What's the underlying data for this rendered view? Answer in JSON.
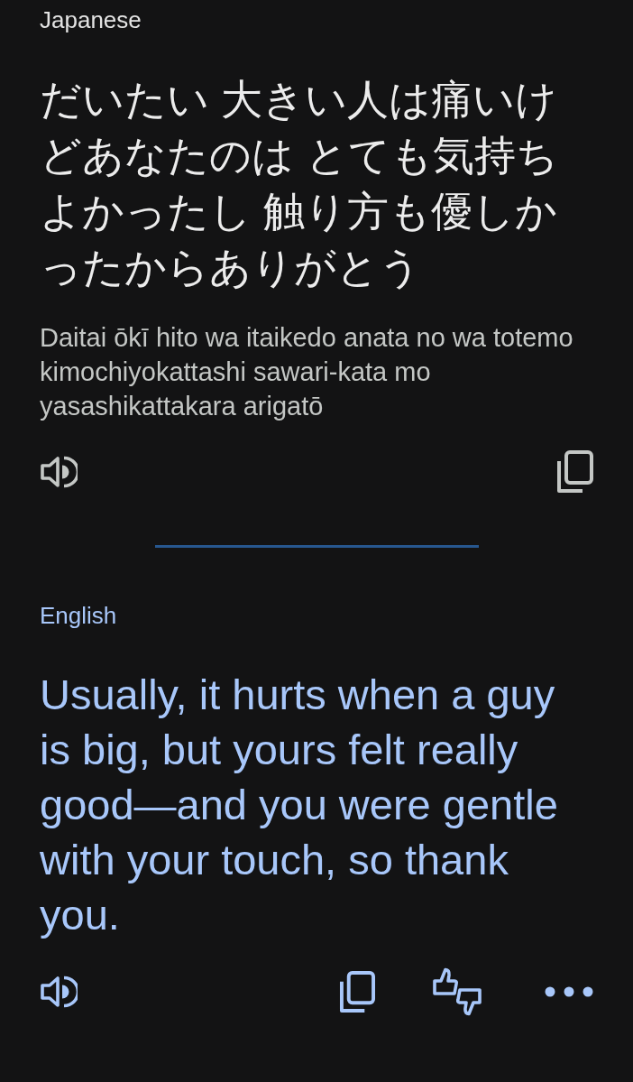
{
  "source": {
    "language": "Japanese",
    "text": "だいたい 大きい人は痛いけどあなたのは とても気持ちよかったし 触り方も優しかったからありがとう",
    "transliteration": "Daitai ōkī hito wa itaikedo anata no wa totemo kimochiyokattashi sawari-kata mo yasashikattakara arigatō"
  },
  "target": {
    "language": "English",
    "text": "Usually, it hurts when a guy is big, but yours felt really good—and you were gentle with your touch, so thank you."
  }
}
